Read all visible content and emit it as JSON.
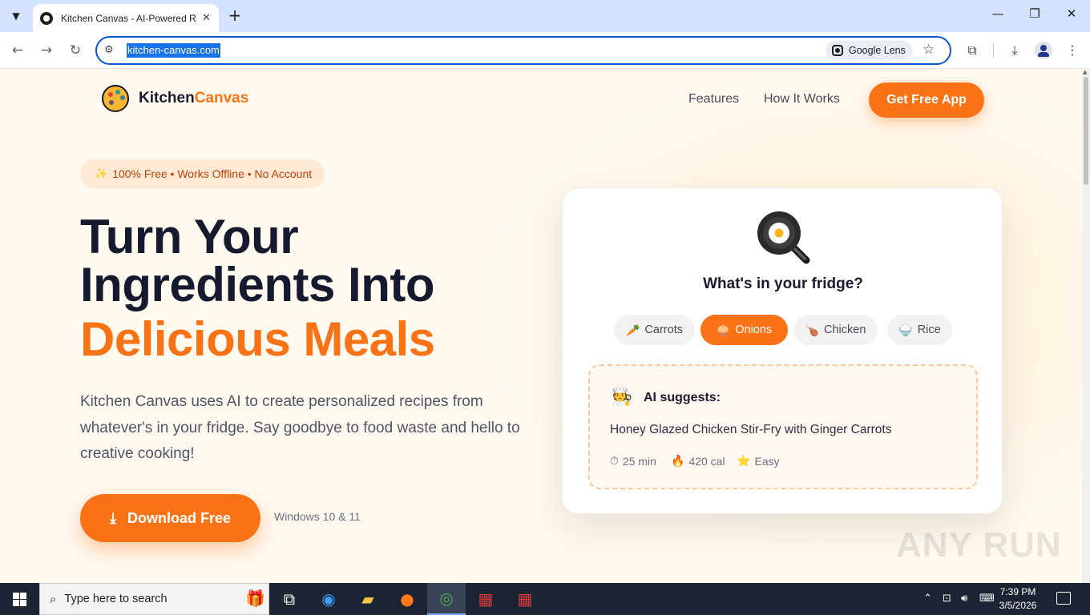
{
  "browser": {
    "tab_title": "Kitchen Canvas - AI-Powered R",
    "url": "kitchen-canvas.com",
    "lens_label": "Google Lens",
    "icons": {
      "tab_search": "chevron-down-icon",
      "tab_close": "close-icon",
      "new_tab": "plus-icon",
      "back": "arrow-left-icon",
      "forward": "arrow-right-icon",
      "reload": "reload-icon",
      "site_info": "tune-icon",
      "bookmark": "star-icon",
      "extensions": "puzzle-icon",
      "downloads": "download-icon",
      "profile": "person-icon",
      "menu": "kebab-icon"
    },
    "window_controls": {
      "minimize": "—",
      "restore": "❐",
      "close": "✕"
    }
  },
  "site": {
    "logo": {
      "part1": "Kitchen",
      "part2": "Canvas"
    },
    "nav": {
      "features": "Features",
      "how_it_works": "How It Works",
      "cta": "Get Free App"
    },
    "badge": "100% Free • Works Offline • No Account",
    "hero": {
      "line1": "Turn Your",
      "line2": "Ingredients Into",
      "line3": "Delicious Meals",
      "description": "Kitchen Canvas uses AI to create personalized recipes from whatever's in your fridge. Say goodbye to food waste and hello to creative cooking!",
      "download_label": "Download Free",
      "download_note": "Windows 10 & 11"
    },
    "card": {
      "title": "What's in your fridge?",
      "chips": [
        {
          "emoji": "🥕",
          "label": "Carrots",
          "active": false
        },
        {
          "emoji": "🧅",
          "label": "Onions",
          "active": true
        },
        {
          "emoji": "🍗",
          "label": "Chicken",
          "active": false
        },
        {
          "emoji": "🍚",
          "label": "Rice",
          "active": false
        }
      ],
      "ai_label": "AI suggests:",
      "recipe": "Honey Glazed Chicken Stir-Fry with Ginger Carrots",
      "meta": {
        "time": "25 min",
        "calories": "420 cal",
        "difficulty": "Easy"
      }
    },
    "watermark": "ANY RUN"
  },
  "taskbar": {
    "search_placeholder": "Type here to search",
    "time": "7:39 PM",
    "date": "3/5/2026"
  },
  "colors": {
    "accent": "#f97316",
    "text_dark": "#161a2e",
    "page_bg": "#fff9ef",
    "browser_chrome": "#d3e3fd"
  }
}
